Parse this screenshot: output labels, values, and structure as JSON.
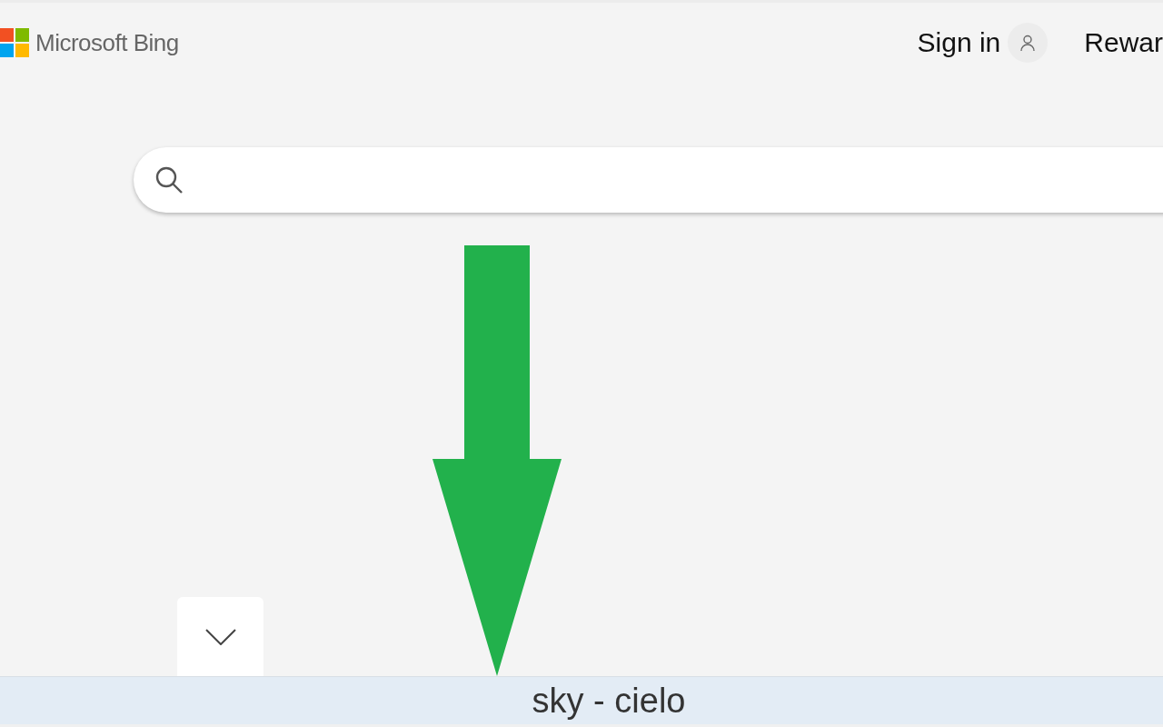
{
  "header": {
    "logo_text": "Microsoft Bing",
    "sign_in": "Sign in",
    "rewards": "Rewar"
  },
  "caption": {
    "text": "sky - cielo"
  }
}
